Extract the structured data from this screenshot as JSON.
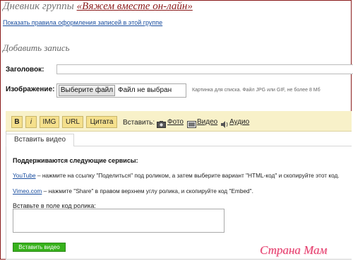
{
  "header": {
    "title_prefix": "Дневник группы ",
    "group_name": "«Вяжем вместе он-лайн»",
    "rules_link": "Показать правила оформления записей в этой группе"
  },
  "form": {
    "heading": "Добавить запись",
    "title_label": "Заголовок:",
    "title_value": "",
    "image_label": "Изображение:",
    "choose_file_button": "Выберите файл",
    "file_status": "Файл не выбран",
    "image_hint": "Картинка для списка. Файл JPG или GIF, не более 8 Мб"
  },
  "toolbar": {
    "bold": "B",
    "italic": "i",
    "img": "IMG",
    "url": "URL",
    "quote": "Цитата",
    "insert_label": "Вставить:",
    "photo": "Фото",
    "video": "Видео",
    "audio": "Аудио"
  },
  "video_panel": {
    "tab_label": "Вставить видео",
    "services_title": "Поддерживаются следующие сервисы:",
    "youtube_link": "YouTube",
    "youtube_text": " – нажмите на ссылку \"Поделиться\" под роликом, а затем выберите вариант \"HTML-код\" и скопируйте этот код.",
    "vimeo_link": "Vimeo.com",
    "vimeo_text": " – нажмите \"Share\" в правом верхнем углу ролика, и скопируйте код \"Embed\".",
    "paste_label": "Вставьте в поле код ролика:",
    "code_value": "",
    "submit_button": "Вставить видео"
  },
  "watermark": "Страна Мам",
  "colors": {
    "frame": "#8a1a1a",
    "link": "#1b4fa0",
    "toolbar_bg": "#f8f1c9",
    "toolbar_button": "#f5e08c",
    "submit": "#37b21c",
    "watermark": "#e4406e"
  }
}
